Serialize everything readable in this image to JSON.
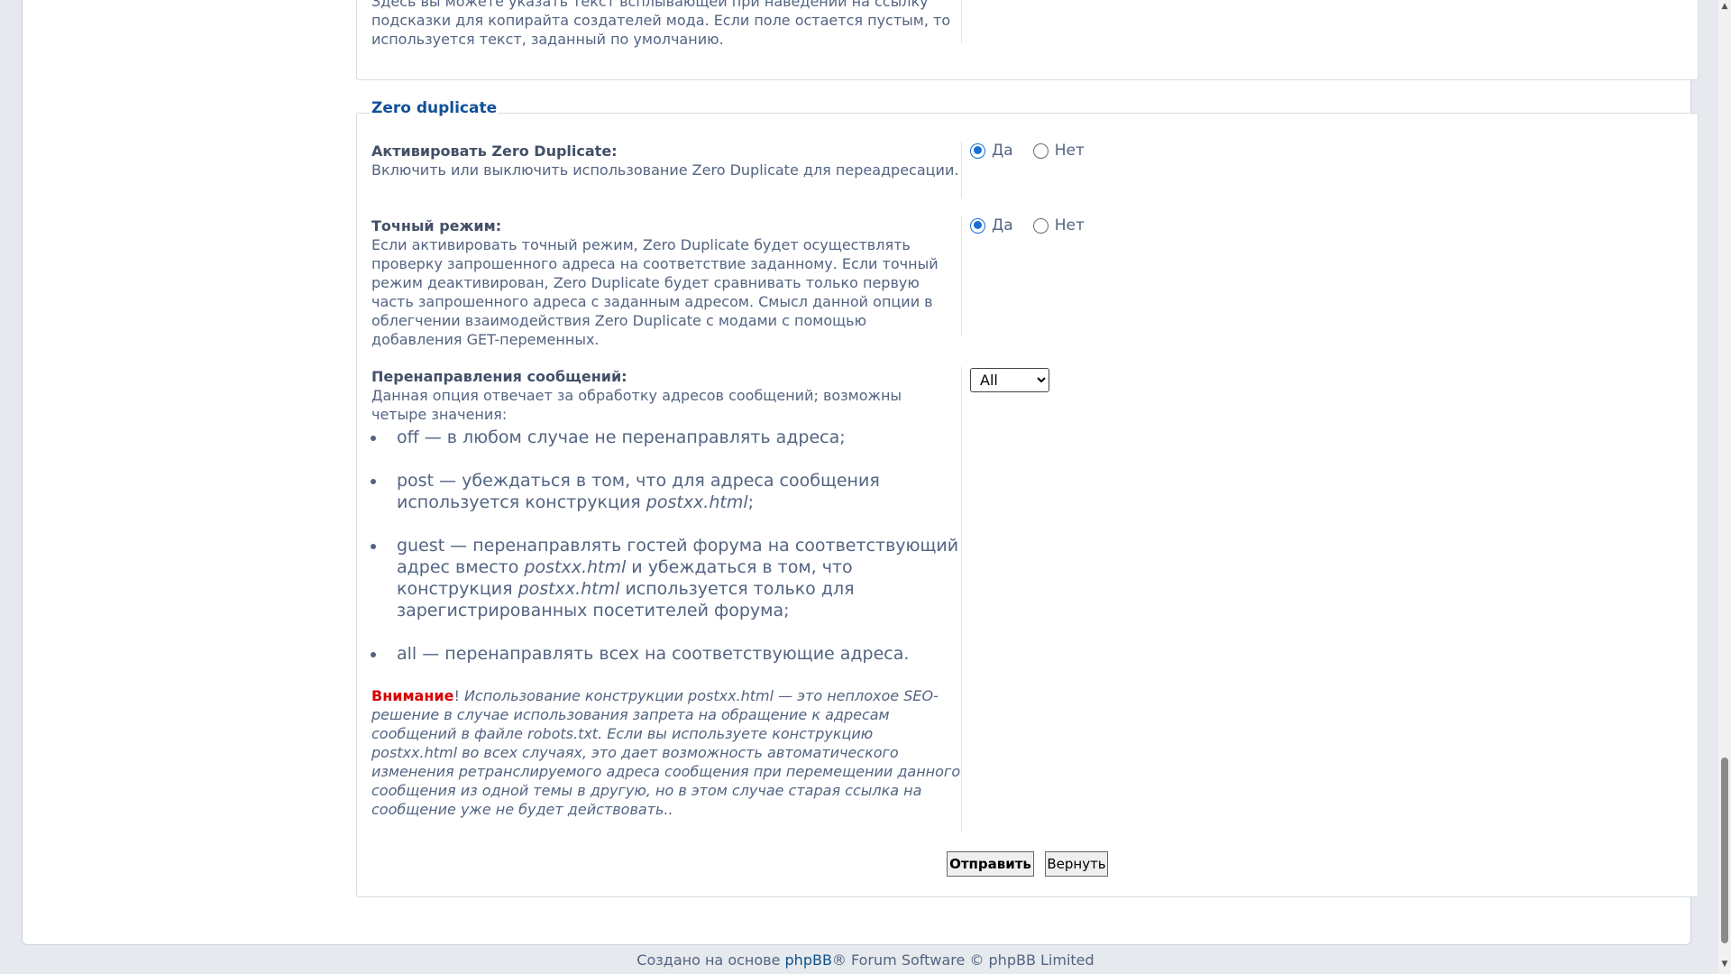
{
  "top_section": {
    "description": "Здесь вы можете указать текст всплывающей при наведении на ссылку подсказки для копирайта создателей мода. Если поле остается пустым, то используется текст, заданный по умолчанию."
  },
  "zero_duplicate": {
    "legend": "Zero duplicate",
    "activate": {
      "label": "Активировать Zero Duplicate:",
      "description": "Включить или выключить использование Zero Duplicate для переадресации.",
      "yes": "Да",
      "no": "Нет",
      "selected": "yes"
    },
    "strict": {
      "label": "Точный режим:",
      "description": "Если активировать точный режим, Zero Duplicate будет осуществлять проверку запрошенного адреса на соответствие заданному. Если точный режим деактивирован, Zero Duplicate будет сравнивать только первую часть запрошенного адреса с заданным адресом. Смысл данной опции в облегчении взаимодействия Zero Duplicate с модами с помощью добавления GET-переменных.",
      "yes": "Да",
      "no": "Нет",
      "selected": "yes"
    },
    "redirects": {
      "label": "Перенаправления сообщений:",
      "description": "Данная опция отвечает за обработку адресов сообщений; возможны четыре значения:",
      "options": [
        {
          "text": "off — в любом случае не перенаправлять адреса;"
        },
        {
          "pre": "post — убеждаться в том, что для адреса сообщения используется конструкция ",
          "em": "postxx.html",
          "post": ";"
        },
        {
          "pre": "guest — перенаправлять гостей форума на соответствующий адрес вместо ",
          "em": "postxx.html",
          "mid": " и убеждаться в том, что конструкция ",
          "em2": "postxx.html",
          "post": " используется только для зарегистрированных посетителей форума;"
        },
        {
          "text": "all — перенаправлять всех на соответствующие адреса."
        }
      ],
      "warning_word": "Внимание",
      "warning_mark": "!",
      "warning_text": " Использование конструкции postxx.html — это неплохое SEO-решение в случае использования запрета на обращение к адресам сообщений в файле robots.txt. Если вы используете конструкцию postxx.html во всех случаях, это дает возможность автоматического изменения ретранслируемого адреса сообщения при перемещении данного сообщения из одной темы в другую, но в этом случае старая ссылка на сообщение уже не будет действовать..",
      "select_value": "All"
    },
    "submit_label": "Отправить",
    "reset_label": "Вернуть"
  },
  "footer": {
    "prefix": "Создано на основе ",
    "link": "phpBB",
    "suffix": "® Forum Software © phpBB Limited"
  }
}
